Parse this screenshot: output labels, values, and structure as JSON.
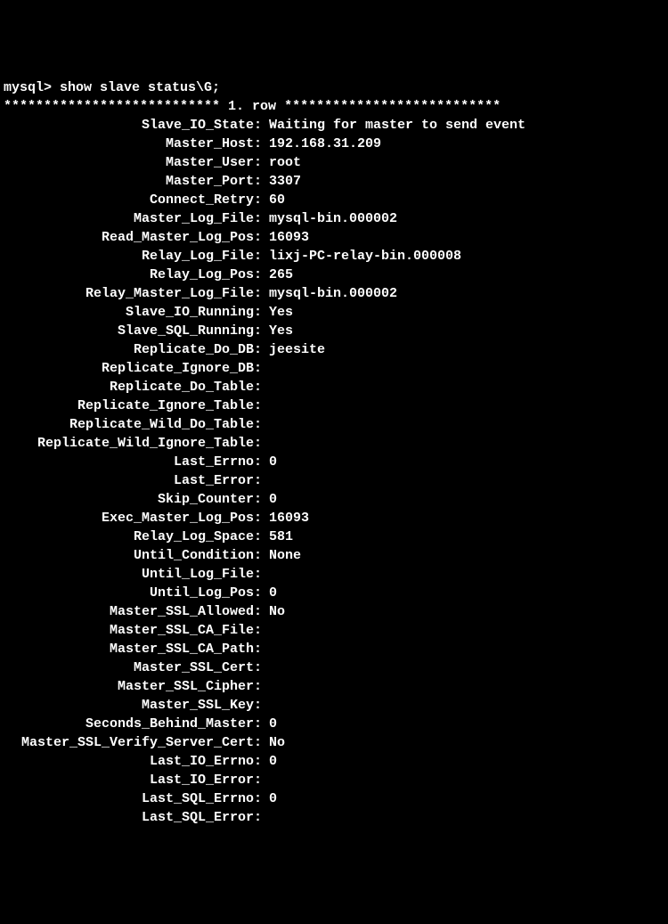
{
  "prompt_line": "mysql> show slave status\\G;",
  "header_prefix": "***************************",
  "header_center": " 1. row ",
  "header_suffix": "***************************",
  "rows": [
    {
      "label": "Slave_IO_State:",
      "value": "Waiting for master to send event"
    },
    {
      "label": "Master_Host:",
      "value": "192.168.31.209"
    },
    {
      "label": "Master_User:",
      "value": "root"
    },
    {
      "label": "Master_Port:",
      "value": "3307"
    },
    {
      "label": "Connect_Retry:",
      "value": "60"
    },
    {
      "label": "Master_Log_File:",
      "value": "mysql-bin.000002"
    },
    {
      "label": "Read_Master_Log_Pos:",
      "value": "16093"
    },
    {
      "label": "Relay_Log_File:",
      "value": "lixj-PC-relay-bin.000008"
    },
    {
      "label": "Relay_Log_Pos:",
      "value": "265"
    },
    {
      "label": "Relay_Master_Log_File:",
      "value": "mysql-bin.000002"
    },
    {
      "label": "Slave_IO_Running:",
      "value": "Yes"
    },
    {
      "label": "Slave_SQL_Running:",
      "value": "Yes"
    },
    {
      "label": "Replicate_Do_DB:",
      "value": "jeesite"
    },
    {
      "label": "Replicate_Ignore_DB:",
      "value": ""
    },
    {
      "label": "Replicate_Do_Table:",
      "value": ""
    },
    {
      "label": "Replicate_Ignore_Table:",
      "value": ""
    },
    {
      "label": "Replicate_Wild_Do_Table:",
      "value": ""
    },
    {
      "label": "Replicate_Wild_Ignore_Table:",
      "value": ""
    },
    {
      "label": "Last_Errno:",
      "value": "0"
    },
    {
      "label": "Last_Error:",
      "value": ""
    },
    {
      "label": "Skip_Counter:",
      "value": "0"
    },
    {
      "label": "Exec_Master_Log_Pos:",
      "value": "16093"
    },
    {
      "label": "Relay_Log_Space:",
      "value": "581"
    },
    {
      "label": "Until_Condition:",
      "value": "None"
    },
    {
      "label": "Until_Log_File:",
      "value": ""
    },
    {
      "label": "Until_Log_Pos:",
      "value": "0"
    },
    {
      "label": "Master_SSL_Allowed:",
      "value": "No"
    },
    {
      "label": "Master_SSL_CA_File:",
      "value": ""
    },
    {
      "label": "Master_SSL_CA_Path:",
      "value": ""
    },
    {
      "label": "Master_SSL_Cert:",
      "value": ""
    },
    {
      "label": "Master_SSL_Cipher:",
      "value": ""
    },
    {
      "label": "Master_SSL_Key:",
      "value": ""
    },
    {
      "label": "Seconds_Behind_Master:",
      "value": "0"
    },
    {
      "label": "Master_SSL_Verify_Server_Cert:",
      "value": "No"
    },
    {
      "label": "Last_IO_Errno:",
      "value": "0"
    },
    {
      "label": "Last_IO_Error:",
      "value": ""
    },
    {
      "label": "Last_SQL_Errno:",
      "value": "0"
    },
    {
      "label": "Last_SQL_Error:",
      "value": ""
    }
  ]
}
